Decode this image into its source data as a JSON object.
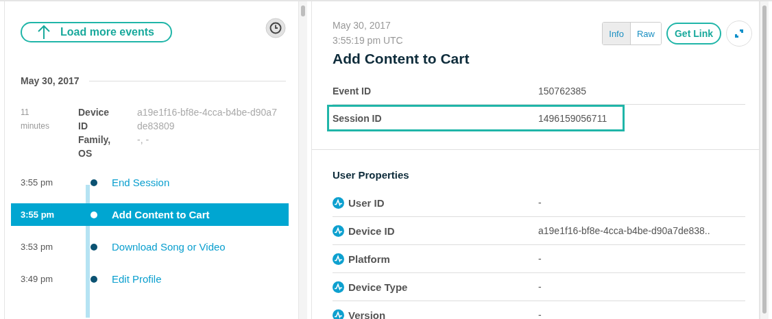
{
  "timeline": {
    "load_more": "Load more events",
    "date": "May 30, 2017",
    "session": {
      "ago": "11 minutes",
      "fields": [
        {
          "label": "Device ID",
          "value": "a19e1f16-bf8e-4cca-b4be-d90a7de83809"
        },
        {
          "label": "Family, OS",
          "value": "-, -"
        }
      ]
    },
    "events": [
      {
        "time": "3:55 pm",
        "name": "End Session",
        "selected": false
      },
      {
        "time": "3:55 pm",
        "name": "Add Content to Cart",
        "selected": true
      },
      {
        "time": "3:53 pm",
        "name": "Download Song or Video",
        "selected": false
      },
      {
        "time": "3:49 pm",
        "name": "Edit Profile",
        "selected": false
      }
    ]
  },
  "detail": {
    "date": "May 30, 2017",
    "time": "3:55:19 pm UTC",
    "view_tabs": [
      {
        "label": "Info",
        "selected": true
      },
      {
        "label": "Raw",
        "selected": false
      }
    ],
    "get_link": "Get Link",
    "title": "Add Content to Cart",
    "fields": [
      {
        "label": "Event ID",
        "value": "150762385",
        "highlighted": false
      },
      {
        "label": "Session ID",
        "value": "1496159056711",
        "highlighted": true
      }
    ],
    "user_properties": {
      "title": "User Properties",
      "rows": [
        {
          "label": "User ID",
          "value": "-"
        },
        {
          "label": "Device ID",
          "value": "a19e1f16-bf8e-4cca-b4be-d90a7de838.."
        },
        {
          "label": "Platform",
          "value": "-"
        },
        {
          "label": "Device Type",
          "value": "-"
        },
        {
          "label": "Version",
          "value": "-"
        }
      ]
    }
  }
}
